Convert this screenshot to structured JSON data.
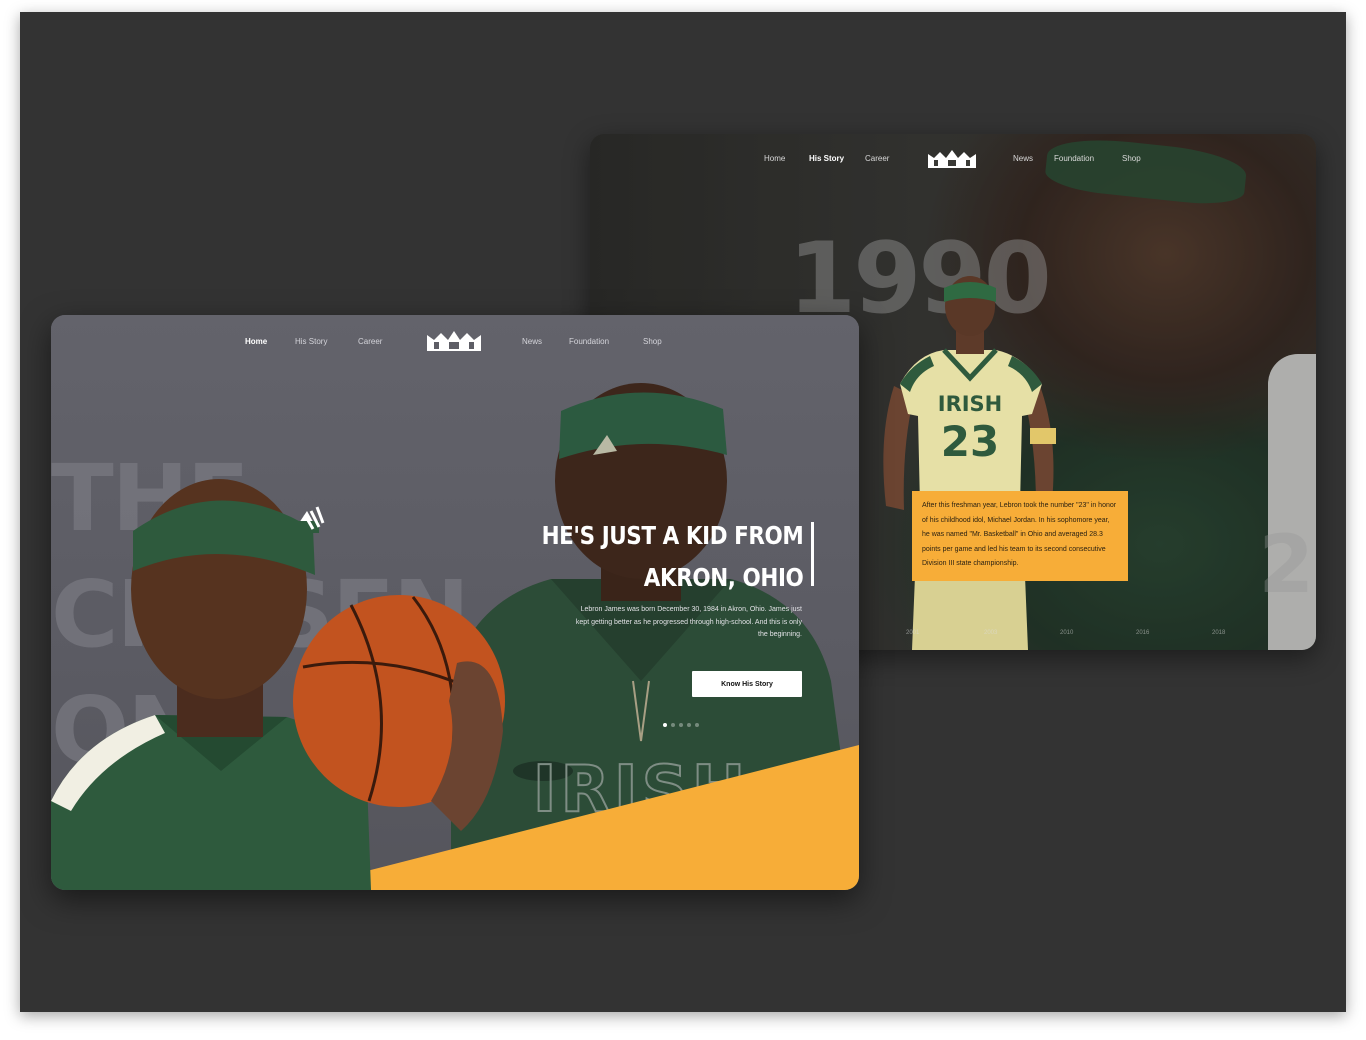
{
  "back_screen": {
    "nav": {
      "left": [
        "Home",
        "His Story",
        "Career"
      ],
      "right": [
        "News",
        "Foundation",
        "Shop"
      ],
      "active": "His Story"
    },
    "year": "1990",
    "corner_number": "2",
    "jersey": {
      "text": "IRISH",
      "number": "23"
    },
    "caption": "After this freshman year, Lebron took the number \"23\" in honor of his childhood idol, Michael Jordan. In his sophomore year, he was named \"Mr. Basketball\" in Ohio and averaged 28.3 points per game and led his team to its second consecutive Division III state championship.",
    "timeline": [
      "2001",
      "2003",
      "2010",
      "2016",
      "2018"
    ]
  },
  "front_screen": {
    "nav": {
      "left": [
        "Home",
        "His Story",
        "Career"
      ],
      "right": [
        "News",
        "Foundation",
        "Shop"
      ],
      "active": "Home"
    },
    "ghost_text": "THE\nCHOSEN\nONE",
    "title_line1": "HE'S JUST A KID FROM",
    "title_line2": "AKRON, OHIO",
    "description": "Lebron James was born December 30, 1984 in Akron, Ohio. James just kept getting better as he progressed through high-school. And this is only the beginning.",
    "cta_label": "Know His Story",
    "carousel": {
      "count": 5,
      "active_index": 0
    },
    "jersey_text": "IRISH"
  },
  "colors": {
    "accent_yellow": "#f7ad38",
    "jersey_green": "#2f5a3d",
    "background": "#333333",
    "front_bg": "#5d5d65"
  },
  "icons": {
    "logo": "lebron-crown-logo",
    "headband_mark": "three-stripes-logo"
  }
}
